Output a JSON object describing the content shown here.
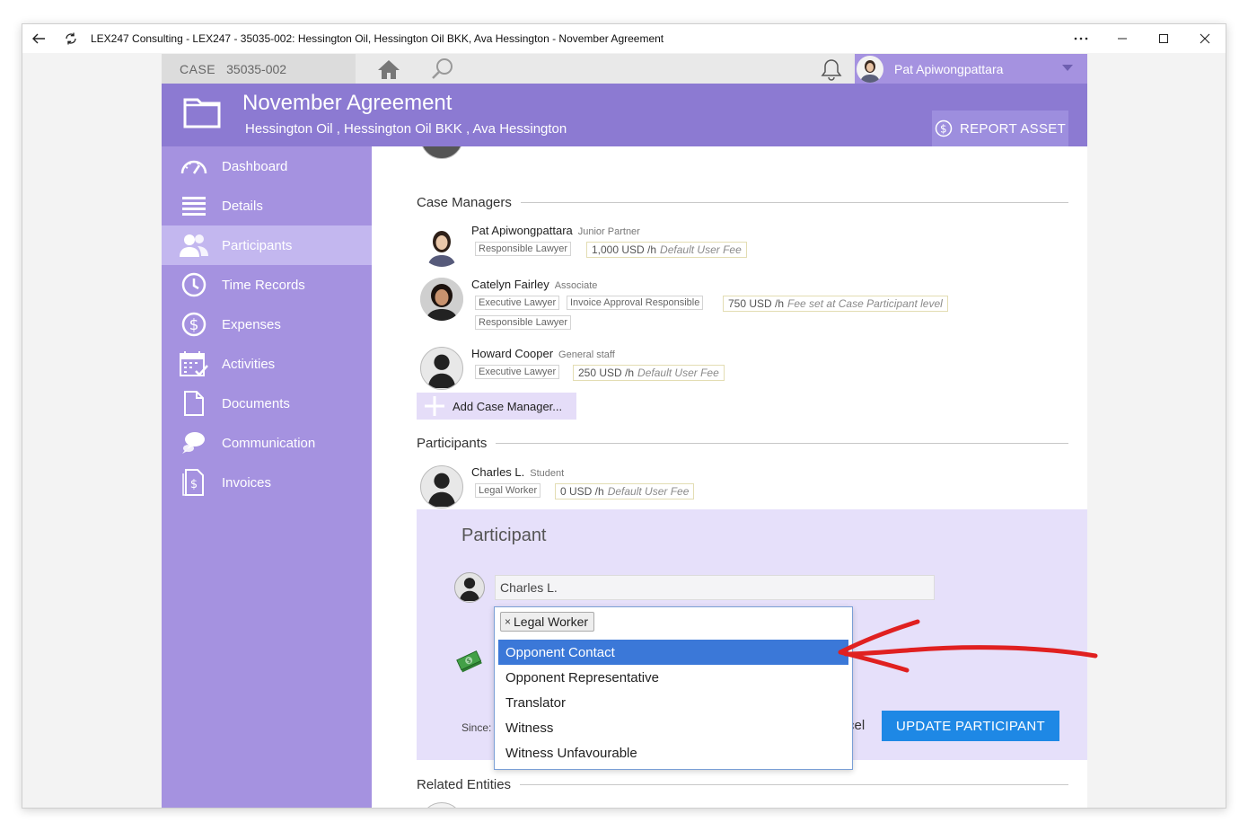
{
  "window": {
    "title": "LEX247 Consulting - LEX247 - 35035-002: Hessington Oil, Hessington Oil BKK, Ava Hessington - November Agreement"
  },
  "topbar": {
    "case_key": "CASE",
    "case_number": "35035-002",
    "user_name": "Pat Apiwongpattara"
  },
  "header": {
    "title": "November Agreement",
    "subtitle": "Hessington Oil ,  Hessington Oil BKK ,  Ava Hessington",
    "report_button": "REPORT ASSET"
  },
  "sidebar": {
    "items": [
      {
        "label": "Dashboard",
        "icon": "gauge-icon"
      },
      {
        "label": "Details",
        "icon": "list-icon"
      },
      {
        "label": "Participants",
        "icon": "people-icon"
      },
      {
        "label": "Time Records",
        "icon": "clock-icon"
      },
      {
        "label": "Expenses",
        "icon": "dollar-circle-icon"
      },
      {
        "label": "Activities",
        "icon": "calendar-check-icon"
      },
      {
        "label": "Documents",
        "icon": "document-icon"
      },
      {
        "label": "Communication",
        "icon": "chat-bubbles-icon"
      },
      {
        "label": "Invoices",
        "icon": "invoice-icon"
      }
    ],
    "active_index": 2
  },
  "sections": {
    "case_managers": "Case Managers",
    "participants": "Participants",
    "related_entities": "Related Entities"
  },
  "case_managers": [
    {
      "name": "Pat Apiwongpattara",
      "role": "Junior Partner",
      "tags": [
        "Responsible Lawyer"
      ],
      "fee": "1,000 USD /h",
      "fee_note": "Default User Fee"
    },
    {
      "name": "Catelyn Fairley",
      "role": "Associate",
      "tags": [
        "Executive Lawyer",
        "Invoice Approval Responsible",
        "Responsible Lawyer"
      ],
      "fee": "750 USD /h",
      "fee_note": "Fee set at Case Participant level"
    },
    {
      "name": "Howard Cooper",
      "role": "General staff",
      "tags": [
        "Executive Lawyer"
      ],
      "fee": "250 USD /h",
      "fee_note": "Default User Fee"
    }
  ],
  "add_case_manager": "Add Case Manager...",
  "participants": [
    {
      "name": "Charles L.",
      "role": "Student",
      "tags": [
        "Legal Worker"
      ],
      "fee": "0 USD /h",
      "fee_note": "Default User Fee"
    }
  ],
  "participant_panel": {
    "title": "Participant",
    "name_value": "Charles L.",
    "since_label": "Since:",
    "cancel_partial": "cel",
    "update_button": "UPDATE PARTICIPANT"
  },
  "dropdown": {
    "selected_tag": "Legal Worker",
    "remove_glyph": "×",
    "options": [
      "Opponent Contact",
      "Opponent Representative",
      "Translator",
      "Witness",
      "Witness Unfavourable"
    ],
    "highlighted_index": 0
  },
  "colors": {
    "sidebar": "#a592e0",
    "header": "#8c7ad2",
    "highlight": "#3b78d8",
    "update_button": "#1e88e5",
    "annotation_arrow": "#e02020"
  }
}
